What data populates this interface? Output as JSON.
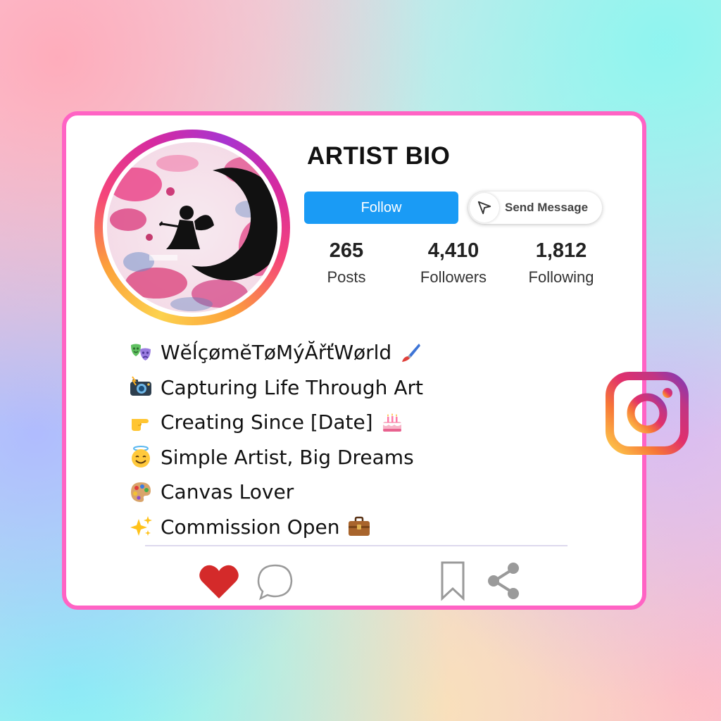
{
  "profile": {
    "username": "ARTIST BIO",
    "follow_label": "Follow",
    "message_label": "Send Message"
  },
  "stats": [
    {
      "value": "265",
      "label": "Posts"
    },
    {
      "value": "4,410",
      "label": "Followers"
    },
    {
      "value": "1,812",
      "label": "Following"
    }
  ],
  "bio": [
    {
      "icon": "theater-masks-icon",
      "text": "WĕĺçømĕTøMýĂřťWørld",
      "trailing_icon": "paintbrush-icon"
    },
    {
      "icon": "camera-flash-icon",
      "text": "Capturing Life Through Art"
    },
    {
      "icon": "pointing-hand-icon",
      "text": "Creating Since [Date]",
      "trailing_icon": "birthday-cake-icon"
    },
    {
      "icon": "smiling-halo-face-icon",
      "text": "Simple Artist, Big Dreams"
    },
    {
      "icon": "artist-palette-icon",
      "text": "Canvas Lover"
    },
    {
      "icon": "sparkles-icon",
      "text": "Commission Open",
      "trailing_icon": "briefcase-icon"
    }
  ],
  "actions": [
    "heart-icon",
    "comment-icon",
    "bookmark-icon",
    "share-icon"
  ],
  "colors": {
    "card_border": "#ff63c4",
    "follow_button": "#1a9bf5",
    "heart": "#d42a2a"
  }
}
